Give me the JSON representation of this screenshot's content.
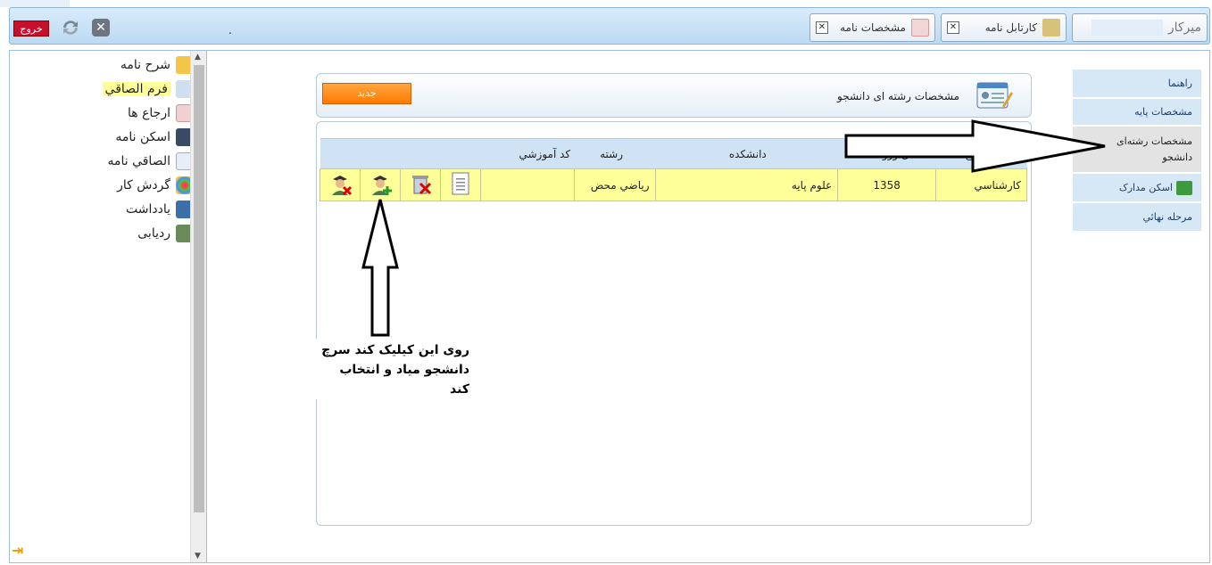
{
  "topbar": {
    "logout_label": "خروج",
    "tabs": [
      {
        "label": "ميركار",
        "icon": "desk-icon"
      },
      {
        "label": "كارتابل نامه",
        "icon": "box-icon"
      },
      {
        "label": "مشخصات نامه",
        "icon": "form-icon"
      }
    ],
    "dot": "."
  },
  "sidebar": {
    "items": [
      {
        "label": "شرح نامه",
        "icon": "envelope-icon"
      },
      {
        "label": "فرم الصاقي",
        "icon": "attach-form-icon",
        "highlighted": true
      },
      {
        "label": "ارجاع ها",
        "icon": "refer-icon"
      },
      {
        "label": "اسکن نامه",
        "icon": "scanner-icon"
      },
      {
        "label": "الصاقي نامه",
        "icon": "mail-attach-icon"
      },
      {
        "label": "گردش کار",
        "icon": "workflow-icon"
      },
      {
        "label": "يادداشت",
        "icon": "note-icon"
      },
      {
        "label": "ردیابی",
        "icon": "tracking-icon"
      }
    ]
  },
  "right_menu": {
    "items": [
      {
        "label": "راهنما"
      },
      {
        "label": "مشخصات پايه"
      },
      {
        "label": "مشخصات رشته‌ای دانشجو",
        "selected": true
      },
      {
        "label": "اسکن مدارک",
        "icon": "printer-icon"
      },
      {
        "label": "مرحله نهائي"
      }
    ]
  },
  "panel": {
    "title": "مشخصات رشته ای دانشجو",
    "new_button": "جديد"
  },
  "table": {
    "headers": {
      "maghta": "مقطع",
      "sal": "سال ورود",
      "daneshkade": "دانشکده",
      "reshte": "رشته",
      "kod": "کد آموزشي"
    },
    "rows": [
      {
        "maghta": "کارشناسي",
        "sal": "1358",
        "daneshkade": "علوم پايه",
        "reshte": "رياضي محض",
        "kod": ""
      }
    ]
  },
  "annotation": {
    "line1": "روی این کیلیک کند سرچ",
    "line2": "دانشجو میاد و انتخاب کند"
  },
  "colors": {
    "accent_orange": "#ff8a1a",
    "header_blue": "#d0e3f5",
    "row_yellow": "#ffff99",
    "logout_red": "#c8102e"
  }
}
